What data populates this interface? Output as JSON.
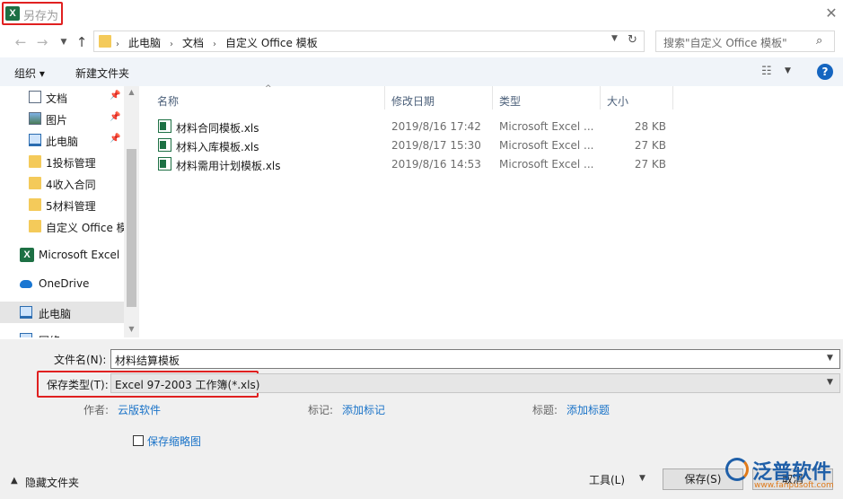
{
  "window": {
    "title": "另存为",
    "app_icon": "excel-icon"
  },
  "address": {
    "path": [
      "此电脑",
      "文档",
      "自定义 Office 模板"
    ],
    "search_placeholder": "搜索\"自定义 Office 模板\""
  },
  "toolbar": {
    "organize_label": "组织 ▾",
    "new_folder_label": "新建文件夹"
  },
  "nav": {
    "items": [
      {
        "label": "文档",
        "icon": "document-icon",
        "pinned": true
      },
      {
        "label": "图片",
        "icon": "picture-icon",
        "pinned": true
      },
      {
        "label": "此电脑",
        "icon": "computer-icon",
        "pinned": true
      },
      {
        "label": "1投标管理",
        "icon": "folder-icon",
        "pinned": false
      },
      {
        "label": "4收入合同",
        "icon": "folder-icon",
        "pinned": false
      },
      {
        "label": "5材料管理",
        "icon": "folder-icon",
        "pinned": false
      },
      {
        "label": "自定义 Office 模板",
        "icon": "folder-icon",
        "pinned": false
      },
      {
        "label": "Microsoft Excel",
        "icon": "excel-icon",
        "pinned": false
      },
      {
        "label": "OneDrive",
        "icon": "onedrive-icon",
        "pinned": false
      },
      {
        "label": "此电脑",
        "icon": "computer-icon",
        "pinned": false,
        "selected": true
      },
      {
        "label": "网络",
        "icon": "network-icon",
        "pinned": false
      }
    ]
  },
  "filelist": {
    "columns": {
      "name": "名称",
      "modified": "修改日期",
      "type": "类型",
      "size": "大小"
    },
    "files": [
      {
        "name": "材料合同模板.xls",
        "modified": "2019/8/16 17:42",
        "type": "Microsoft Excel ...",
        "size": "28 KB"
      },
      {
        "name": "材料入库模板.xls",
        "modified": "2019/8/17 15:30",
        "type": "Microsoft Excel ...",
        "size": "27 KB"
      },
      {
        "name": "材料需用计划模板.xls",
        "modified": "2019/8/16 14:53",
        "type": "Microsoft Excel ...",
        "size": "27 KB"
      }
    ]
  },
  "form": {
    "filename_label": "文件名(N):",
    "filename_value": "材料结算模板",
    "filetype_label": "保存类型(T):",
    "filetype_value": "Excel 97-2003 工作簿(*.xls)",
    "author_label": "作者:",
    "author_value": "云版软件",
    "tags_label": "标记:",
    "tags_value": "添加标记",
    "title_label": "标题:",
    "title_value": "添加标题",
    "thumbnail_label": "保存缩略图",
    "thumbnail_checked": false
  },
  "footer": {
    "hide_folders_label": "隐藏文件夹",
    "tools_label": "工具(L)",
    "save_label": "保存(S)",
    "cancel_label": "取消"
  },
  "watermark": {
    "brand": "泛普软件",
    "url": "www.fanpusoft.com"
  },
  "colors": {
    "highlight_border": "#e02020",
    "excel_green": "#1d7044",
    "link_blue": "#1a73c8",
    "toolbar_bg": "#f0f4f9"
  }
}
